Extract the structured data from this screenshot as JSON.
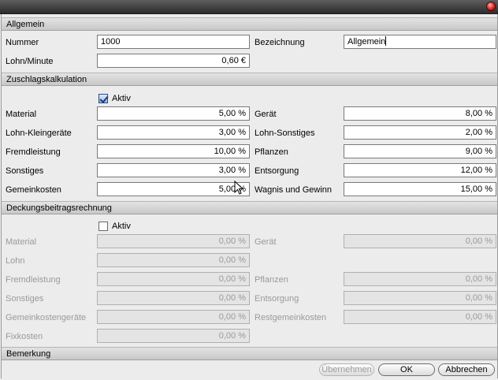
{
  "window": {
    "title": ""
  },
  "sections": {
    "allgemein": {
      "title": "Allgemein",
      "nummer_label": "Nummer",
      "nummer_value": "1000",
      "bezeichnung_label": "Bezeichnung",
      "bezeichnung_value": "Allgemein",
      "lohn_minute_label": "Lohn/Minute",
      "lohn_minute_value": "0,60 €"
    },
    "zuschlag": {
      "title": "Zuschlagskalkulation",
      "aktiv_label": "Aktiv",
      "aktiv_checked": true,
      "rows": [
        {
          "left_label": "Material",
          "left_value": "5,00 %",
          "right_label": "Gerät",
          "right_value": "8,00 %"
        },
        {
          "left_label": "Lohn-Kleingeräte",
          "left_value": "3,00 %",
          "right_label": "Lohn-Sonstiges",
          "right_value": "2,00 %"
        },
        {
          "left_label": "Fremdleistung",
          "left_value": "10,00 %",
          "right_label": "Pflanzen",
          "right_value": "9,00 %"
        },
        {
          "left_label": "Sonstiges",
          "left_value": "3,00 %",
          "right_label": "Entsorgung",
          "right_value": "12,00 %"
        },
        {
          "left_label": "Gemeinkosten",
          "left_value": "5,00 %",
          "right_label": "Wagnis und Gewinn",
          "right_value": "15,00 %"
        }
      ]
    },
    "deckung": {
      "title": "Deckungsbeitragsrechnung",
      "aktiv_label": "Aktiv",
      "aktiv_checked": false,
      "rows": [
        {
          "left_label": "Material",
          "left_value": "0,00 %",
          "right_label": "Gerät",
          "right_value": "0,00 %"
        },
        {
          "left_label": "Lohn",
          "left_value": "0,00 %",
          "right_label": "",
          "right_value": ""
        },
        {
          "left_label": "Fremdleistung",
          "left_value": "0,00 %",
          "right_label": "Pflanzen",
          "right_value": "0,00 %"
        },
        {
          "left_label": "Sonstiges",
          "left_value": "0,00 %",
          "right_label": "Entsorgung",
          "right_value": "0,00 %"
        },
        {
          "left_label": "Gemeinkostengeräte",
          "left_value": "0,00 %",
          "right_label": "Restgemeinkosten",
          "right_value": "0,00 %"
        },
        {
          "left_label": "Fixkosten",
          "left_value": "0,00 %",
          "right_label": "",
          "right_value": ""
        }
      ]
    },
    "bemerkung": {
      "title": "Bemerkung"
    }
  },
  "buttons": {
    "apply_label": "Übernehmen",
    "ok_label": "OK",
    "cancel_label": "Abbrechen"
  },
  "colors": {
    "close_button": "#e23b3b",
    "checkbox_accent": "#2c4b85"
  }
}
